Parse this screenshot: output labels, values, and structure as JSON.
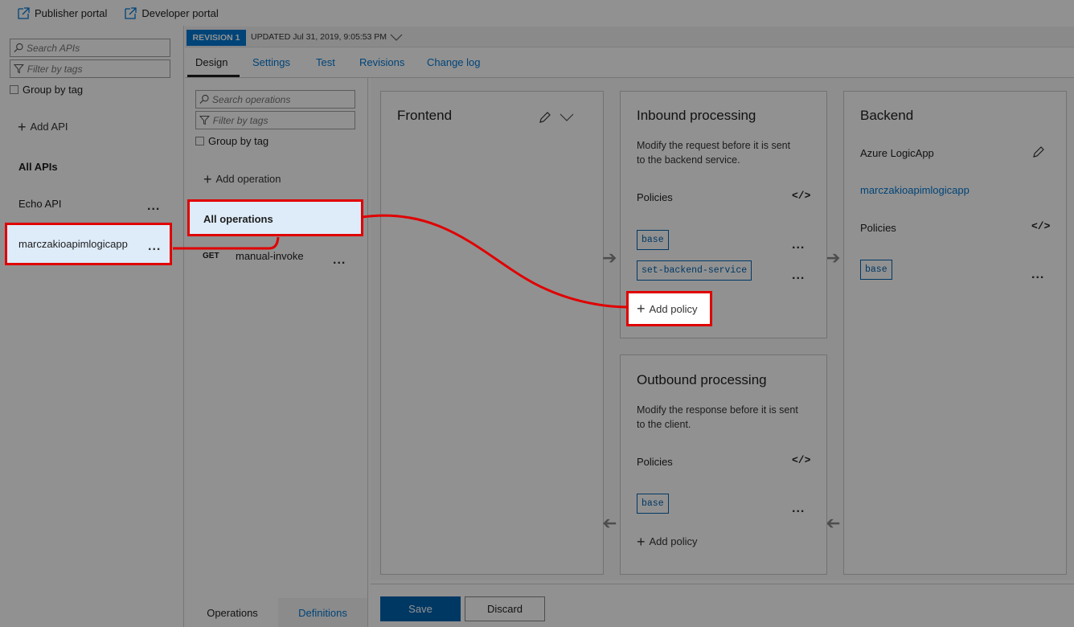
{
  "topbar": {
    "publisher_portal": "Publisher portal",
    "developer_portal": "Developer portal"
  },
  "api_sidebar": {
    "search_placeholder": "Search APIs",
    "filter_placeholder": "Filter by tags",
    "group_by_tag": "Group by tag",
    "add_api": "Add API",
    "all_apis": "All APIs",
    "apis": [
      {
        "name": "Echo API"
      },
      {
        "name": "marczakioapimlogicapp"
      }
    ]
  },
  "revision": {
    "badge": "REVISION 1",
    "updated": "UPDATED Jul 31, 2019, 9:05:53 PM"
  },
  "tabs": [
    "Design",
    "Settings",
    "Test",
    "Revisions",
    "Change log"
  ],
  "operations": {
    "search_placeholder": "Search operations",
    "filter_placeholder": "Filter by tags",
    "group_by_tag": "Group by tag",
    "add_operation": "Add operation",
    "all_operations": "All operations",
    "items": [
      {
        "method": "GET",
        "name": "manual-invoke"
      }
    ],
    "bottom_tabs": [
      "Operations",
      "Definitions"
    ]
  },
  "frontend": {
    "title": "Frontend"
  },
  "inbound": {
    "title": "Inbound processing",
    "description_line1": "Modify the request before it is sent",
    "description_line2": "to the backend service.",
    "policies_label": "Policies",
    "policies": [
      "base",
      "set-backend-service"
    ],
    "add_policy": "Add policy"
  },
  "outbound": {
    "title": "Outbound processing",
    "description_line1": "Modify the response before it is sent",
    "description_line2": "to the client.",
    "policies_label": "Policies",
    "policies": [
      "base"
    ],
    "add_policy": "Add policy"
  },
  "backend": {
    "title": "Backend",
    "type": "Azure LogicApp",
    "link": "marczakioapimlogicapp",
    "policies_label": "Policies",
    "policies": [
      "base"
    ]
  },
  "actions": {
    "save": "Save",
    "discard": "Discard"
  },
  "colors": {
    "accent": "#0078d4",
    "highlight_border": "#e00000",
    "selected_bg": "#deecf9",
    "save_bg": "#0063b1"
  }
}
